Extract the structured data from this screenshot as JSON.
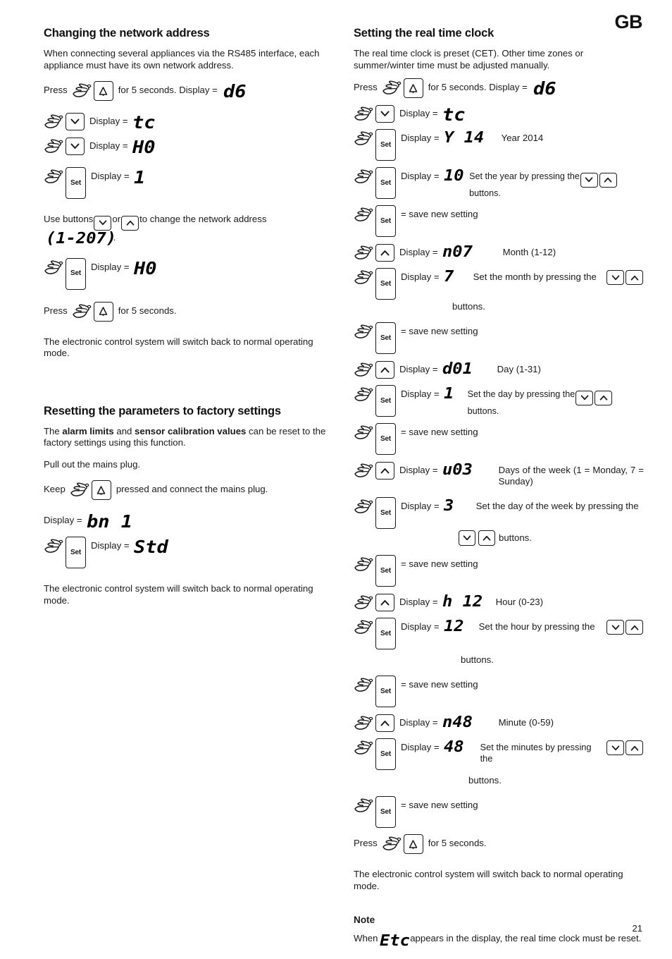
{
  "header": {
    "language_badge": "GB"
  },
  "page_number": "21",
  "left_column": {
    "title": "Changing the network address",
    "intro": "When connecting several appliances via the RS485 interface, each appliance must have its own network address.",
    "steps": [
      {
        "prefix": "Press",
        "icon": "hand-alarm-button-icon",
        "text": "for 5 seconds. Display =",
        "display": "d6"
      },
      {
        "icon": "hand-down-button-icon",
        "text": "Display =",
        "display": "tc"
      },
      {
        "icon": "hand-down-button-icon",
        "text": "Display =",
        "display": "H0"
      },
      {
        "icon": "hand-set-button-icon",
        "text": "Display =",
        "display": "1"
      }
    ],
    "use_buttons_text_a": "Use buttons",
    "use_buttons_or": "or",
    "use_buttons_text_b": "to change the network address",
    "address_range": "(1-207)",
    "address_range_suffix": ".",
    "step_set_h0": {
      "icon": "hand-set-button-icon",
      "text": "Display =",
      "display": "H0"
    },
    "press_5s": {
      "prefix": "Press",
      "icon": "hand-alarm-button-icon",
      "text": "for 5 seconds."
    },
    "closing": "The electronic control system will switch back to normal operating mode.",
    "reset_title": "Resetting the parameters to factory settings",
    "reset_intro_a": "The ",
    "reset_intro_b": "alarm limits",
    "reset_intro_c": " and ",
    "reset_intro_d": "sensor calibration values",
    "reset_intro_e": " can be reset to the factory settings using this function.",
    "pull_plug": "Pull out the mains plug.",
    "keep_pressed": {
      "prefix": "Keep",
      "icon": "hand-alarm-button-icon",
      "text": "pressed and connect the mains plug."
    },
    "display_bn1_label": "Display =",
    "display_bn1_value": "bn 1",
    "step_std": {
      "icon": "hand-set-button-icon",
      "text": "Display =",
      "display": "Std"
    },
    "reset_closing": "The electronic control system will switch back to normal operating mode."
  },
  "right_column": {
    "title": "Setting the real time clock",
    "intro": "The real time clock is preset (CET). Other time zones or summer/winter time must be adjusted manually.",
    "press_5s_start": {
      "prefix": "Press",
      "icon": "hand-alarm-button-icon",
      "text": "for 5 seconds. Display =",
      "display": "d6"
    },
    "steps": [
      {
        "icon": "hand-down-button-icon",
        "text": "Display =",
        "display": "tc",
        "desc": ""
      },
      {
        "icon": "hand-set-button-icon",
        "text": "Display =",
        "display": "Y 14",
        "desc": "Year 2014"
      },
      {
        "icon": "hand-set-button-icon",
        "text": "Display =",
        "display": "10",
        "desc_a": "Set the year by pressing the",
        "desc_b": "buttons.",
        "has_chevrons": true
      },
      {
        "icon": "hand-set-button-icon",
        "text": "= save new setting",
        "display": "",
        "desc": ""
      },
      {
        "icon": "hand-up-button-icon",
        "text": "Display =",
        "display": "n07",
        "desc": "Month (1-12)"
      },
      {
        "icon": "hand-set-button-icon",
        "text": "Display =",
        "display": "7",
        "desc_a": "Set the month by pressing the",
        "desc_b": "buttons.",
        "has_chevrons": true
      },
      {
        "icon": "hand-set-button-icon",
        "text": "= save new setting",
        "display": "",
        "desc": ""
      },
      {
        "icon": "hand-up-button-icon",
        "text": "Display =",
        "display": "d01",
        "desc": "Day (1-31)"
      },
      {
        "icon": "hand-set-button-icon",
        "text": "Display =",
        "display": "1",
        "desc_a": "Set the day by pressing the",
        "desc_b": "buttons.",
        "has_chevrons": true
      },
      {
        "icon": "hand-set-button-icon",
        "text": "= save new setting",
        "display": "",
        "desc": ""
      },
      {
        "icon": "hand-up-button-icon",
        "text": "Display =",
        "display": "u03",
        "desc": "Days of the week (1 = Monday, 7 = Sunday)"
      },
      {
        "icon": "hand-set-button-icon",
        "text": "Display =",
        "display": "3",
        "desc_a": "Set the day of the week by pressing the",
        "desc_b": "buttons.",
        "has_chevrons": true
      },
      {
        "icon": "hand-set-button-icon",
        "text": "= save new setting",
        "display": "",
        "desc": ""
      },
      {
        "icon": "hand-up-button-icon",
        "text": "Display =",
        "display": "h 12",
        "desc": "Hour (0-23)"
      },
      {
        "icon": "hand-set-button-icon",
        "text": "Display =",
        "display": "12",
        "desc_a": "Set the hour by pressing the",
        "desc_b": "buttons.",
        "has_chevrons": true
      },
      {
        "icon": "hand-set-button-icon",
        "text": "= save new setting",
        "display": "",
        "desc": ""
      },
      {
        "icon": "hand-up-button-icon",
        "text": "Display =",
        "display": "n48",
        "desc": "Minute (0-59)"
      },
      {
        "icon": "hand-set-button-icon",
        "text": "Display =",
        "display": "48",
        "desc_a": "Set the minutes by pressing the",
        "desc_b": "buttons.",
        "has_chevrons": true
      },
      {
        "icon": "hand-set-button-icon",
        "text": "= save new setting",
        "display": "",
        "desc": ""
      }
    ],
    "press_5s_end": {
      "prefix": "Press",
      "icon": "hand-alarm-button-icon",
      "text": "for 5 seconds."
    },
    "closing": "The electronic control system will switch back to normal operating mode.",
    "note_title": "Note",
    "note_text_a": "When",
    "note_display": "Etc",
    "note_text_b": "appears in the display, the real time clock must be reset."
  },
  "icons": {
    "set_button_label": "Set",
    "alarm_button": "alarm-bell-glyph",
    "chevron_down": "chevron-down-glyph",
    "chevron_up": "chevron-up-glyph",
    "hand": "pointing-hand-glyph"
  }
}
